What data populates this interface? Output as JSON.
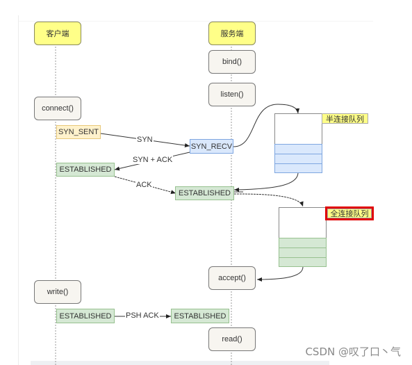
{
  "actors": {
    "client": "客户端",
    "server": "服务端"
  },
  "calls": {
    "bind": "bind()",
    "listen": "listen()",
    "connect": "connect()",
    "accept": "accept()",
    "write": "write()",
    "read": "read()"
  },
  "states": {
    "client_syn_sent": "SYN_SENT",
    "server_syn_recv": "SYN_RECV",
    "client_established_1": "ESTABLISHED",
    "server_established_1": "ESTABLISHED",
    "client_established_2": "ESTABLISHED",
    "server_established_2": "ESTABLISHED"
  },
  "messages": {
    "syn": "SYN",
    "syn_ack": "SYN + ACK",
    "ack": "ACK",
    "psh_ack": "PSH ACK"
  },
  "queues": {
    "half_open": {
      "label": "半连接队列",
      "slots": 3,
      "color": "#dae8fc"
    },
    "full": {
      "label": "全连接队列",
      "slots": 3,
      "color": "#d5e8d4",
      "highlighted": true,
      "highlight_color": "#e00000"
    }
  },
  "watermark": "CSDN @叹了口丶气"
}
